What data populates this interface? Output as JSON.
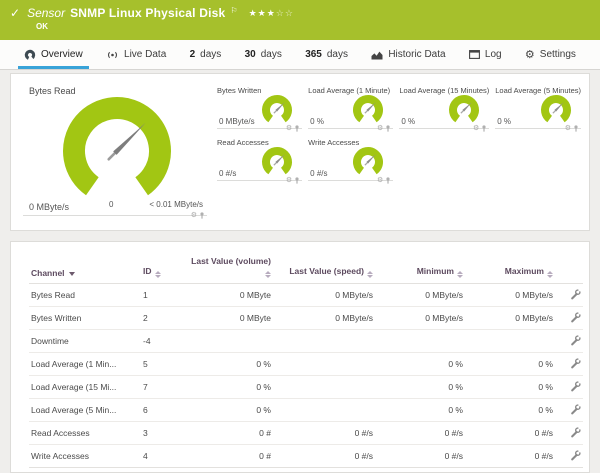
{
  "colors": {
    "header_green": "#a6c02c",
    "gauge_green": "#a2c613",
    "active_tab_blue": "#38a3d8"
  },
  "header": {
    "check_icon": "✓",
    "sensor_label": "Sensor",
    "title": "SNMP Linux Physical Disk",
    "flag_icon": "⚐",
    "stars_filled": "★★★",
    "stars_empty": "☆☆",
    "status": "OK"
  },
  "tabs": [
    {
      "label": "Overview",
      "icon": "gauge-icon",
      "active": true
    },
    {
      "label": "Live Data",
      "icon": "broadcast-icon"
    },
    {
      "num": "2",
      "label": "days"
    },
    {
      "num": "30",
      "label": "days"
    },
    {
      "num": "365",
      "label": "days"
    },
    {
      "label": "Historic Data",
      "icon": "area-chart-icon"
    },
    {
      "label": "Log",
      "icon": "window-icon"
    },
    {
      "label": "Settings",
      "icon": "gear-icon"
    }
  ],
  "gauges": {
    "main": {
      "title": "Bytes Read",
      "value": "0 MByte/s",
      "scale_min": "0",
      "scale_max": "< 0.01 MByte/s"
    },
    "small": [
      {
        "title": "Bytes Written",
        "value": "0 MByte/s"
      },
      {
        "title": "Load Average (1 Minute)",
        "value": "0 %"
      },
      {
        "title": "Load Average (15 Minutes)",
        "value": "0 %"
      },
      {
        "title": "Load Average (5 Minutes)",
        "value": "0 %"
      },
      {
        "title": "Read Accesses",
        "value": "0 #/s"
      },
      {
        "title": "Write Accesses",
        "value": "0 #/s"
      }
    ]
  },
  "table": {
    "columns": [
      {
        "label": "Channel",
        "sorted": true
      },
      {
        "label": "ID",
        "sortable": true
      },
      {
        "label": "Last Value (volume)",
        "sortable": true,
        "numeric": true
      },
      {
        "label": "Last Value (speed)",
        "sortable": true,
        "numeric": true
      },
      {
        "label": "Minimum",
        "sortable": true,
        "numeric": true
      },
      {
        "label": "Maximum",
        "sortable": true,
        "numeric": true
      },
      {
        "label": ""
      }
    ],
    "rows": [
      {
        "channel": "Bytes Read",
        "id": "1",
        "last_volume": "0 MByte",
        "last_speed": "0 MByte/s",
        "minimum": "0 MByte/s",
        "maximum": "0 MByte/s"
      },
      {
        "channel": "Bytes Written",
        "id": "2",
        "last_volume": "0 MByte",
        "last_speed": "0 MByte/s",
        "minimum": "0 MByte/s",
        "maximum": "0 MByte/s"
      },
      {
        "channel": "Downtime",
        "id": "-4",
        "last_volume": "",
        "last_speed": "",
        "minimum": "",
        "maximum": ""
      },
      {
        "channel": "Load Average (1 Min...",
        "id": "5",
        "last_volume": "0 %",
        "last_speed": "",
        "minimum": "0 %",
        "maximum": "0 %"
      },
      {
        "channel": "Load Average (15 Mi...",
        "id": "7",
        "last_volume": "0 %",
        "last_speed": "",
        "minimum": "0 %",
        "maximum": "0 %"
      },
      {
        "channel": "Load Average (5 Min...",
        "id": "6",
        "last_volume": "0 %",
        "last_speed": "",
        "minimum": "0 %",
        "maximum": "0 %"
      },
      {
        "channel": "Read Accesses",
        "id": "3",
        "last_volume": "0 #",
        "last_speed": "0 #/s",
        "minimum": "0 #/s",
        "maximum": "0 #/s"
      },
      {
        "channel": "Write Accesses",
        "id": "4",
        "last_volume": "0 #",
        "last_speed": "0 #/s",
        "minimum": "0 #/s",
        "maximum": "0 #/s"
      }
    ]
  }
}
